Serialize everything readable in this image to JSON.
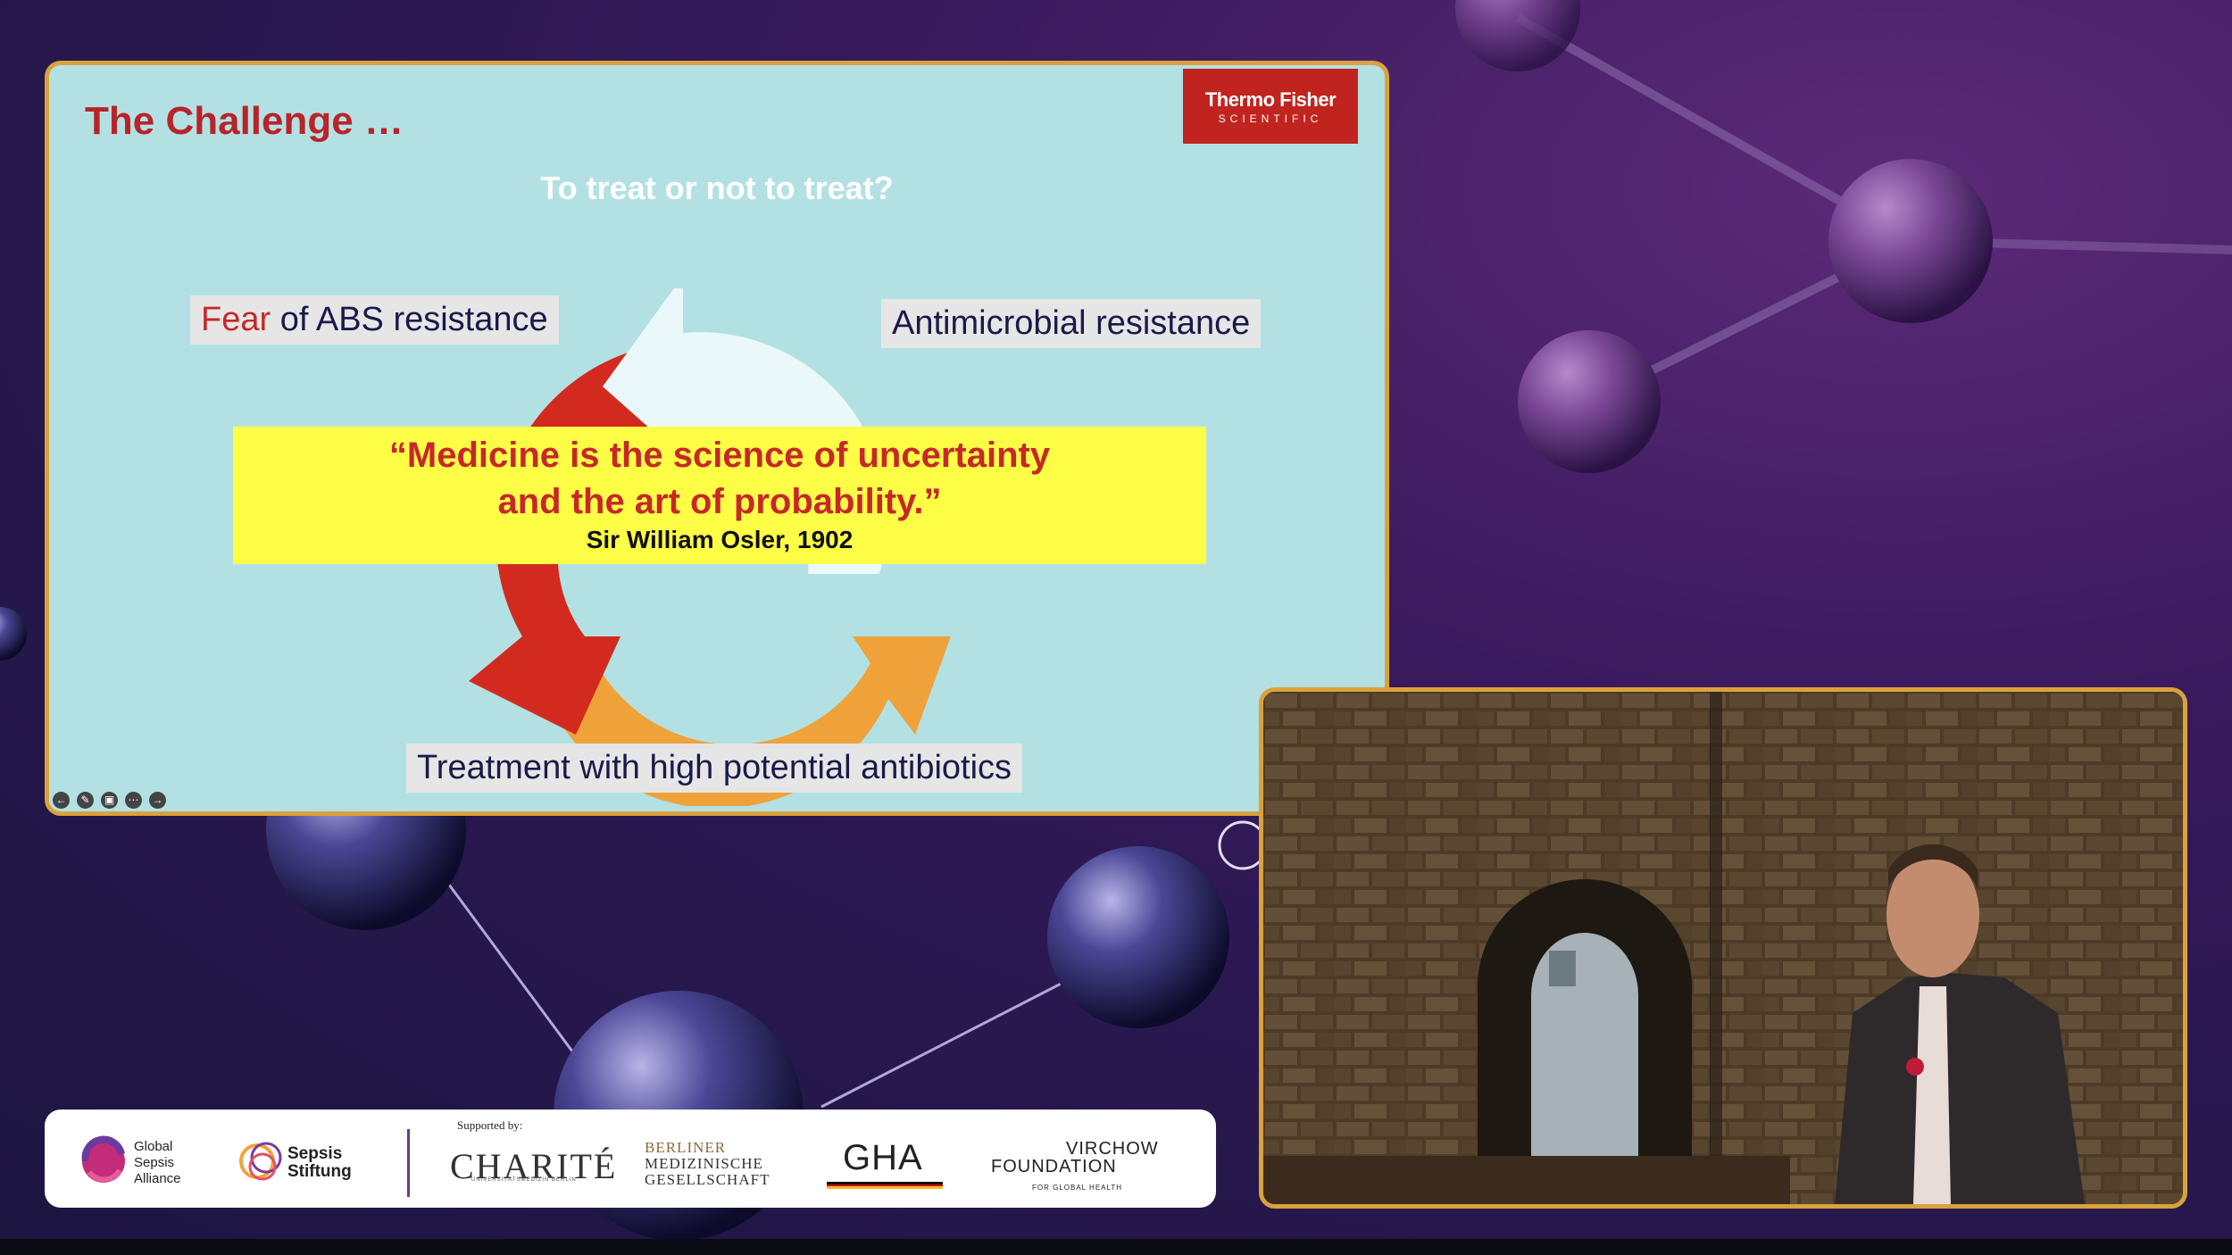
{
  "slide": {
    "title": "The Challenge …",
    "logo": {
      "line1": "Thermo Fisher",
      "line2": "SCIENTIFIC"
    },
    "question": "To treat or not to treat?",
    "label_fear_word": "Fear",
    "label_fear_rest": " of ABS resistance",
    "label_amr": "Antimicrobial resistance",
    "label_treatment": "Treatment with high potential antibiotics",
    "quote_line1": "“Medicine is the science of uncertainty",
    "quote_line2": "and the art of probability.”",
    "quote_author": "Sir William Osler, 1902",
    "controls": [
      "back-icon",
      "pen-icon",
      "captions-icon",
      "more-icon",
      "forward-icon"
    ]
  },
  "sponsors": {
    "gsa": "Global\nSepsis\nAlliance",
    "sepsis_stiftung": "Sepsis\nStiftung",
    "supported_by": "Supported by:",
    "charite": "CHARITÉ",
    "charite_sub": "UNIVERSITÄTSMEDIZIN BERLIN",
    "bmg_line1": "BERLINER",
    "bmg_line2": "MEDIZINISCHE",
    "bmg_line3": "GESELLSCHAFT",
    "gha": "GHA",
    "virchow_line1": "VIRCHOW",
    "virchow_line2": "FOUNDATION",
    "virchow_line3": "FOR GLOBAL HEALTH"
  },
  "colors": {
    "accent_border": "#d9a23c",
    "slide_bg": "#b3e1e3",
    "brand_red": "#c1241e",
    "quote_yellow": "#fefe47",
    "arrow_red": "#d32a1f",
    "arrow_orange": "#f0a23a",
    "arrow_light": "#eaf8fa"
  }
}
